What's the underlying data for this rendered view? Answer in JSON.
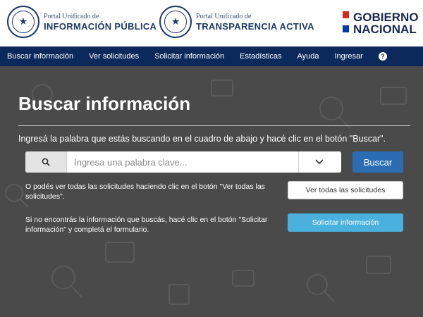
{
  "header": {
    "brand1": {
      "small": "Portal Unificado de",
      "big": "INFORMACIÓN PÚBLICA"
    },
    "brand2": {
      "small": "Portal Unificado de",
      "big": "TRANSPARENCIA ACTIVA"
    },
    "gov": {
      "line1": "GOBIERNO",
      "line2": "NACIONAL"
    },
    "flag_colors": [
      "#d52b1e",
      "#ffffff",
      "#0038a8"
    ]
  },
  "nav": {
    "items": [
      "Buscar información",
      "Ver solicitudes",
      "Solicitar información",
      "Estadísticas",
      "Ayuda",
      "Ingresar"
    ],
    "help_icon": "?"
  },
  "main": {
    "title": "Buscar información",
    "instruction": "Ingresá la palabra que estás buscando en el cuadro de abajo y hacé clic en el botón \"Buscar\".",
    "search": {
      "placeholder": "Ingresa una palabra clave..."
    },
    "search_button": "Buscar",
    "paragraph1": "O podés ver todas las solicitudes haciendo clic en el botón \"Ver todas las solicitudes\".",
    "ver_button": "Ver todas las solicitudes",
    "paragraph2": "Si no encontrás la información que buscás, hacé clic en el botón \"Solicitar información\" y completá el formulario.",
    "solicitar_button": "Solicitar información",
    "colors": {
      "background": "#4a4a4a",
      "nav": "#0b2a5b",
      "primary": "#2a6db3",
      "secondary": "#4ab0dd"
    }
  }
}
